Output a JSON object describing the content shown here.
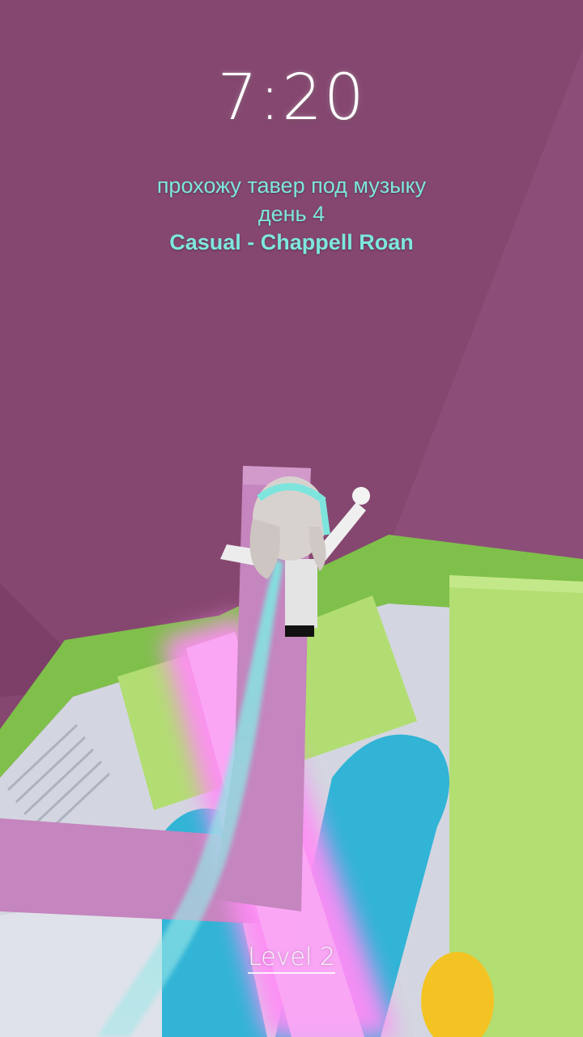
{
  "hud": {
    "timer": "7:20",
    "level_label": "Level 2"
  },
  "caption": {
    "line1": "прохожу тавер под музыку",
    "line2": "день 4",
    "song": "Casual - Chappell Roan"
  },
  "colors": {
    "wall": "#85476f",
    "floor_green": "#b2dd72",
    "rim_green": "#7fc04a",
    "path_pink": "#c585be",
    "neon_pink": "#ff8cf6",
    "blue": "#31b4d6",
    "trail": "#7fe3e0",
    "caption_text": "#7ee7de"
  },
  "icons": {
    "player_avatar": "roblox-avatar-icon"
  }
}
